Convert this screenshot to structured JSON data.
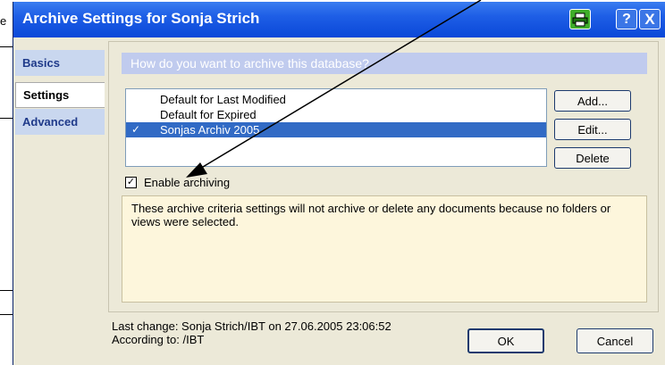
{
  "window": {
    "title": "Archive Settings for Sonja Strich",
    "help_glyph": "?",
    "close_glyph": "X"
  },
  "background": {
    "fragment_letter": "e"
  },
  "sidebar": {
    "tabs": [
      {
        "label": "Basics",
        "selected": false
      },
      {
        "label": "Settings",
        "selected": true
      },
      {
        "label": "Advanced",
        "selected": false
      }
    ]
  },
  "settings": {
    "question": "How do you want to archive this database?",
    "criteria": [
      {
        "label": "Default for Last Modified",
        "checked": false,
        "selected": false,
        "mark": ""
      },
      {
        "label": "Default for Expired",
        "checked": false,
        "selected": false,
        "mark": ""
      },
      {
        "label": "Sonjas Archiv 2005",
        "checked": true,
        "selected": true,
        "mark": "✓"
      }
    ],
    "buttons": {
      "add": "Add...",
      "edit": "Edit...",
      "delete": "Delete"
    },
    "enable_archiving": {
      "label": "Enable archiving",
      "checked": true,
      "mark": "✓"
    },
    "info_text": "These archive criteria settings will not archive or delete any documents because no folders or views were selected."
  },
  "footer": {
    "last_change": "Last change: Sonja Strich/IBT on 27.06.2005 23:06:52",
    "according_to": "According to: /IBT",
    "ok": "OK",
    "cancel": "Cancel"
  },
  "colors": {
    "titlebar": "#0a48d8",
    "selection": "#316ac5",
    "question_bar": "#c0cbee",
    "info_bg": "#fdf6dc"
  }
}
